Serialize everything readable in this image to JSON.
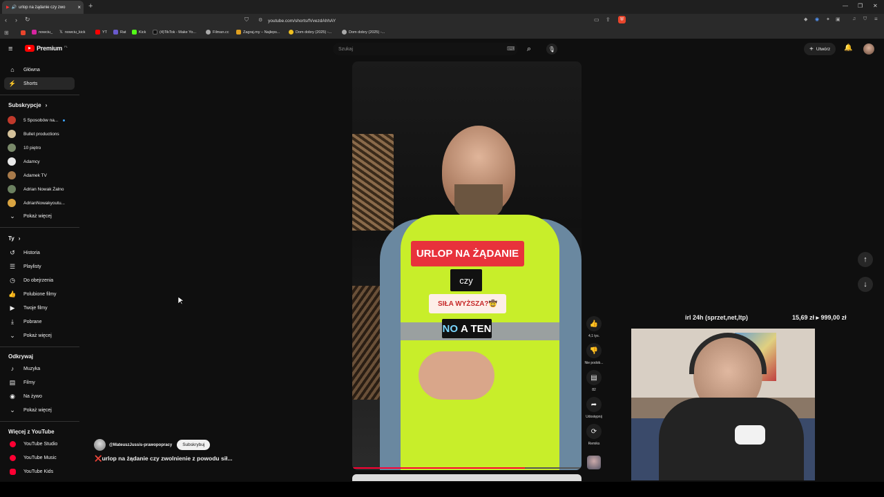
{
  "browser": {
    "tab_title": "urlop na żądanie czy zwo",
    "url": "youtube.com/shorts/fVvezdAhhAY",
    "bookmarks": [
      "nowciu_",
      "nowciu_kick",
      "YT",
      "Rat",
      "Kick",
      "(4)TikTok - Make Yo...",
      "Filman.cc",
      "Zagraj.my – Najleps...",
      "Dom dobry (2025) -...",
      "Dom dobry (2025) -..."
    ]
  },
  "header": {
    "logo_text": "Premium",
    "logo_superscript": "PL",
    "search_placeholder": "Szukaj",
    "create_label": "Utwórz"
  },
  "sidebar": {
    "main": [
      {
        "label": "Główna",
        "icon": "home-icon"
      },
      {
        "label": "Shorts",
        "icon": "shorts-icon",
        "active": true
      }
    ],
    "subscriptions_header": "Subskrypcje",
    "subscriptions": [
      {
        "label": "5 Sposobów na...",
        "color": "#c0392b",
        "dot": true
      },
      {
        "label": "Bullet productions",
        "color": "#d4c19a"
      },
      {
        "label": "10 piętro",
        "color": "#7a8a6a"
      },
      {
        "label": "Adamcy",
        "color": "#e8e8e8"
      },
      {
        "label": "Adamek TV",
        "color": "#a87a4a"
      },
      {
        "label": "Adrian Nowak Żalno",
        "color": "#6b8060"
      },
      {
        "label": "AdrianNowakyoutu...",
        "color": "#d9a441"
      }
    ],
    "show_more": "Pokaż więcej",
    "you_header": "Ty",
    "you": [
      {
        "label": "Historia",
        "icon": "history-icon"
      },
      {
        "label": "Playlisty",
        "icon": "playlist-icon"
      },
      {
        "label": "Do obejrzenia",
        "icon": "clock-icon"
      },
      {
        "label": "Polubione filmy",
        "icon": "like-icon"
      },
      {
        "label": "Twoje filmy",
        "icon": "video-icon"
      },
      {
        "label": "Pobrane",
        "icon": "download-icon"
      }
    ],
    "explore_header": "Odkrywaj",
    "explore": [
      {
        "label": "Muzyka",
        "icon": "music-icon"
      },
      {
        "label": "Filmy",
        "icon": "film-icon"
      },
      {
        "label": "Na żywo",
        "icon": "live-icon"
      }
    ],
    "more_header": "Więcej z YouTube",
    "more": [
      {
        "label": "YouTube Studio"
      },
      {
        "label": "YouTube Music"
      },
      {
        "label": "YouTube Kids"
      }
    ]
  },
  "short": {
    "channel": "@MateuszJussis-prawopopracy",
    "subscribe": "Subskrybuj",
    "title": "❌urlop na żądanie czy zwolnienie z powodu sił...",
    "caption_1": "URLOP NA ŻĄDANIE",
    "caption_2": "czy",
    "caption_3": "SIŁA WYŻSZA?🤠",
    "caption_4a": "NO",
    "caption_4b": "A TEN",
    "likes": "4,1 tys.",
    "dislike": "Nie podob...",
    "comments": "82",
    "share": "Udostępnij",
    "remix": "Remiks"
  },
  "overlay": {
    "left_text": "irl 24h (sprzet,net,ltp)",
    "right_text": "15,69 zł ▸ 999,00 zł"
  }
}
